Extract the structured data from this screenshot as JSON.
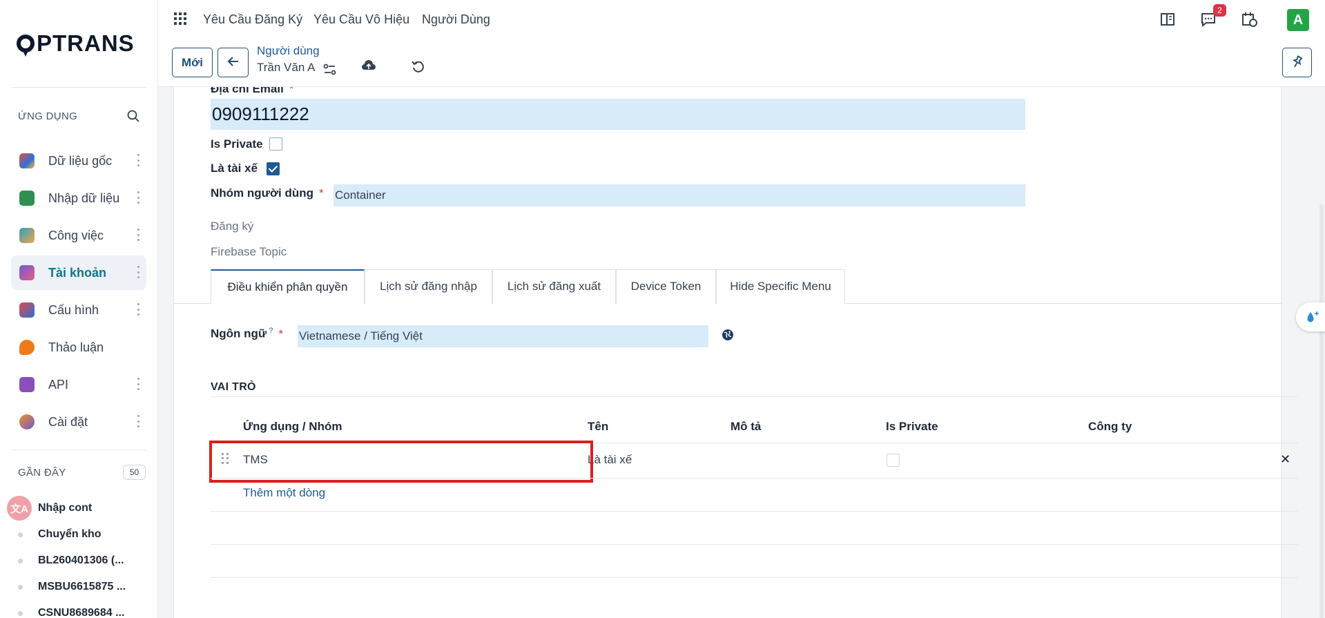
{
  "brand": {
    "logo_text": "PTRANS"
  },
  "topbar": {
    "menus": [
      "Yêu Cầu Đăng Ký",
      "Yêu Cầu Vô Hiệu",
      "Người Dùng"
    ],
    "messages_count": "2",
    "avatar_initial": "A"
  },
  "sidebar": {
    "apps_title": "ỨNG DỤNG",
    "items": [
      {
        "label": "Dữ liệu gốc",
        "icon": "master-data-icon",
        "color": "#e0533e"
      },
      {
        "label": "Nhập dữ liệu",
        "icon": "import-data-icon",
        "color": "#2f8f4e"
      },
      {
        "label": "Công việc",
        "icon": "checkmark-icon",
        "color": "#2aa1c0"
      },
      {
        "label": "Tài khoản",
        "icon": "users-icon",
        "color": "#6d5bd0"
      },
      {
        "label": "Cấu hình",
        "icon": "tools-icon",
        "color": "#e04a4a"
      },
      {
        "label": "Thảo luận",
        "icon": "chat-bubble-icon",
        "color": "#f07a1a"
      },
      {
        "label": "API",
        "icon": "api-icon",
        "color": "#8a4fb8"
      },
      {
        "label": "Cài đặt",
        "icon": "settings-icon",
        "color": "#f28c28"
      }
    ],
    "recent_title": "GẦN ĐÂY",
    "recent_count": "50",
    "recent_items": [
      "Nhập cont",
      "Chuyển kho",
      "BL260401306 (...",
      "MSBU6615875 ...",
      "CSNU8689684 ..."
    ]
  },
  "control": {
    "new_label": "Mới",
    "breadcrumb": "Người dùng",
    "record_name": "Trần Văn A"
  },
  "form": {
    "email_label": "Địa chỉ Email",
    "email_value": "0909111222",
    "is_private_label": "Is Private",
    "is_private_checked": false,
    "is_driver_label": "Là tài xế",
    "is_driver_checked": true,
    "user_group_label": "Nhóm người dùng",
    "user_group_value": "Container",
    "register_label": "Đăng ký",
    "firebase_label": "Firebase Topic",
    "tabs": [
      "Điều khiển phân quyền",
      "Lịch sử đăng nhập",
      "Lịch sử đăng xuất",
      "Device Token",
      "Hide Specific Menu"
    ],
    "language_label": "Ngôn ngữ",
    "language_help": "?",
    "language_value": "Vietnamese / Tiếng Việt",
    "roles_title": "VAI TRÒ",
    "roles_table": {
      "headers": [
        "Ứng dụng / Nhóm",
        "Tên",
        "Mô tả",
        "Is Private",
        "Công ty"
      ],
      "rows": [
        {
          "app_group": "TMS",
          "name": "Là tài xế",
          "description": "",
          "is_private": false,
          "company": ""
        }
      ],
      "add_line_label": "Thêm một dòng"
    }
  },
  "colors": {
    "primary": "#1f5a96",
    "input_bg": "#d7ebf9",
    "highlight": "#dc1f1f",
    "danger": "#dc3545"
  }
}
